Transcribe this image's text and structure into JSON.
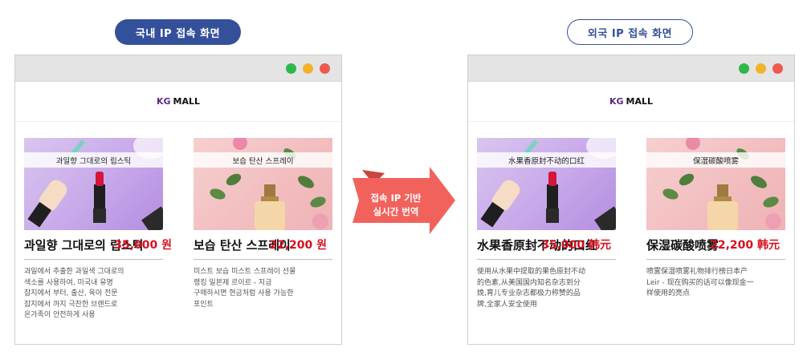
{
  "labels": {
    "domestic": "국내 IP 접속 화면",
    "foreign": "외국 IP 접속 화면"
  },
  "arrow_text": "접속 IP 기반\n실시간 번역",
  "colors": {
    "navy": "#34509a",
    "price_red": "#d8101f",
    "arrow_coral": "#f2625c",
    "dot_green": "#2db84a",
    "dot_yellow": "#f2b32a",
    "dot_red": "#ee5a4d"
  },
  "browsers": {
    "domestic": {
      "brand_mark": "KG",
      "brand_name": "MALL",
      "products": [
        {
          "image_label": "과일향 그대로의 립스틱",
          "title": "과일향 그대로의 립스틱",
          "desc": "과일에서 추출한 과일색 그대로의\n색소를 사용하여, 미국내 유명\n잡지에서 부터, 출산, 육아 전문\n잡지에서 까지 극찬한 브랜드로\n온가족이 안전하게 사용",
          "price": "35,000 원"
        },
        {
          "image_label": "보습 탄산 스프레이",
          "title": "보습 탄산 스프레이",
          "desc": "미스트 보습 미스트 스프레이 선물\n랭킹 일본제 르이르 - 지금\n구매하시면 현금처럼 사용 가능한\n포인트",
          "price": "22,200 원"
        }
      ]
    },
    "foreign": {
      "brand_mark": "KG",
      "brand_name": "MALL",
      "products": [
        {
          "image_label": "水果香原封不动的口红",
          "title": "水果香原封不动的口红",
          "desc": "使用从水果中提取的果色原封不动\n的色素,从美国国内知名杂志到分\n娩,育儿专业杂志都极力称赞的品\n牌,全家人安全使用",
          "price": "35,000 韩元"
        },
        {
          "image_label": "保湿碳酸喷雾",
          "title": "保湿碳酸喷雾",
          "desc": "喷雾保湿喷雾礼物排行榜日本产\nLeir - 现在购买的话可以像现金一\n样使用的亮点",
          "price": "22,200 韩元"
        }
      ]
    }
  }
}
